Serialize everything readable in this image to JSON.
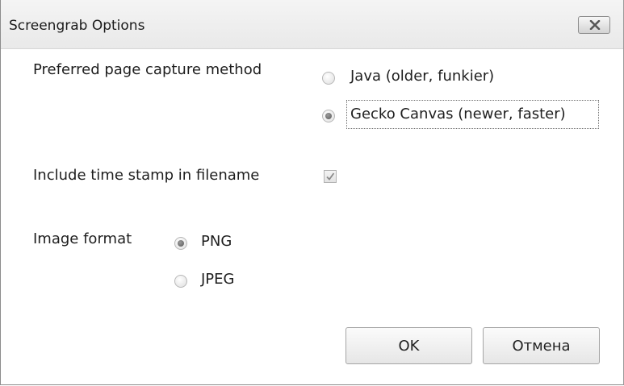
{
  "dialog": {
    "title": "Screengrab Options",
    "capture_method_label": "Preferred page capture method",
    "capture_options": [
      {
        "label": "Java (older, funkier)",
        "selected": false
      },
      {
        "label": "Gecko Canvas (newer, faster)",
        "selected": true
      }
    ],
    "timestamp_label": "Include time stamp in filename",
    "timestamp_checked": true,
    "image_format_label": "Image format",
    "format_options": [
      {
        "label": "PNG",
        "selected": true
      },
      {
        "label": "JPEG",
        "selected": false
      }
    ],
    "ok_label": "OK",
    "cancel_label": "Отмена"
  }
}
